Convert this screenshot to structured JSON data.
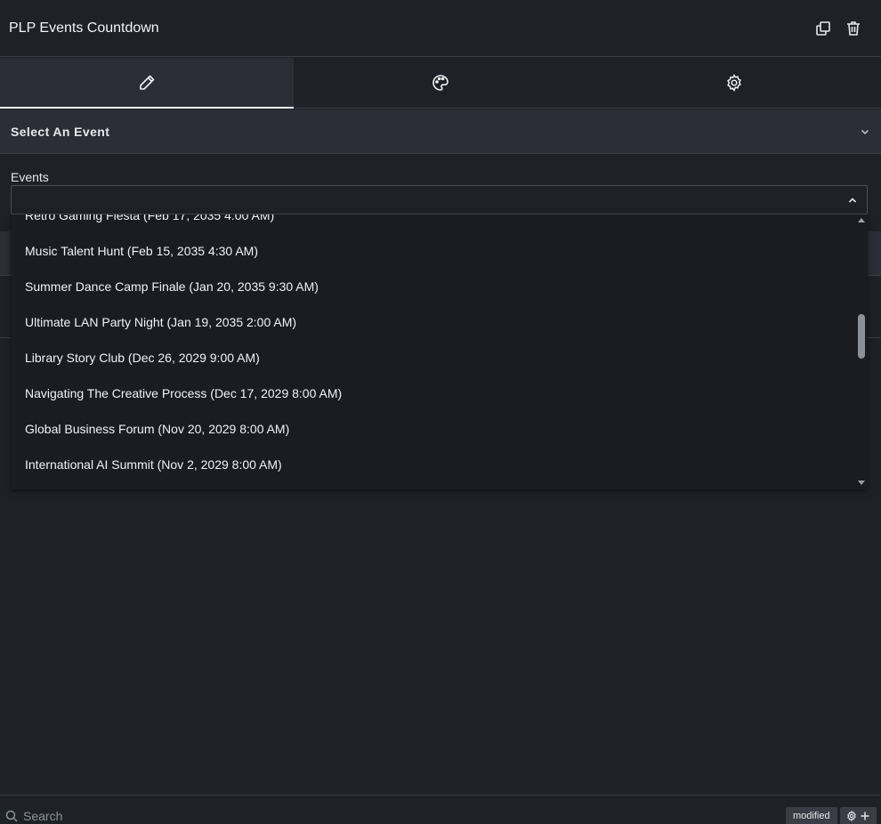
{
  "header": {
    "title": "PLP Events Countdown",
    "icons": [
      "copy-icon",
      "trash-icon"
    ]
  },
  "tabs": [
    {
      "icon": "pencil-icon",
      "active": true
    },
    {
      "icon": "palette-icon",
      "active": false
    },
    {
      "icon": "gear-icon",
      "active": false
    }
  ],
  "section": {
    "title": "Select An Event"
  },
  "events_field": {
    "label": "Events",
    "options": [
      "Retro Gaming Fiesta (Feb 17, 2035 4:00 AM)",
      "Music Talent Hunt (Feb 15, 2035 4:30 AM)",
      "Summer Dance Camp Finale (Jan 20, 2035 9:30 AM)",
      "Ultimate LAN Party Night (Jan 19, 2035 2:00 AM)",
      "Library Story Club (Dec 26, 2029 9:00 AM)",
      "Navigating The Creative Process (Dec 17, 2029 8:00 AM)",
      "Global Business Forum (Nov 20, 2029 8:00 AM)",
      "International AI Summit (Nov 2, 2029 8:00 AM)"
    ]
  },
  "footer": {
    "search_placeholder": "Search",
    "badge": "modified"
  },
  "colors": {
    "background": "#1f2128",
    "panel": "#2b2e36",
    "dropdown": "#1a1c22",
    "text": "#e6e8ec"
  }
}
